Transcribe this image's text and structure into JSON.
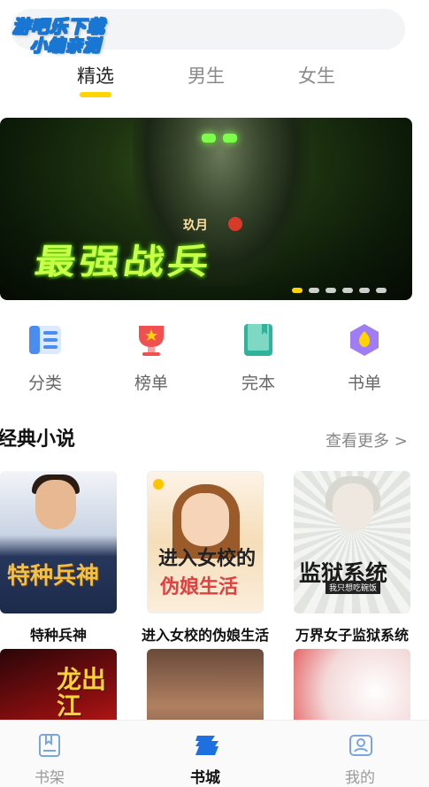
{
  "watermark": {
    "line1": "游吧乐下载",
    "line2": "小编亲测"
  },
  "tabs": [
    {
      "label": "精选",
      "active": true
    },
    {
      "label": "男生",
      "active": false
    },
    {
      "label": "女生",
      "active": false
    }
  ],
  "banner": {
    "author": "玖月",
    "title": "最强战兵",
    "slides": 6,
    "active_slide": 1
  },
  "categories": [
    {
      "label": "分类",
      "icon": "list-icon",
      "color": "#4a8cf0"
    },
    {
      "label": "榜单",
      "icon": "trophy-icon",
      "color": "#f05050"
    },
    {
      "label": "完本",
      "icon": "book-icon",
      "color": "#2fb39a"
    },
    {
      "label": "书单",
      "icon": "badge-icon",
      "color": "#8a5cf0"
    }
  ],
  "section": {
    "title": "经典小说",
    "more": "查看更多 >"
  },
  "books": [
    {
      "title": "特种兵神",
      "cover_text": "特种兵神"
    },
    {
      "title": "进入女校的伪娘生活",
      "cover_text_1": "进入女校的",
      "cover_text_2": "伪娘生活"
    },
    {
      "title": "万界女子监狱系统",
      "cover_text": "监狱系统",
      "cover_sub": "我只想吃碗饭"
    },
    {
      "cover_text": "龙出江"
    },
    {},
    {}
  ],
  "bottom_nav": [
    {
      "label": "书架",
      "icon": "bookshelf-icon",
      "active": false
    },
    {
      "label": "书城",
      "icon": "bookstore-icon",
      "active": true
    },
    {
      "label": "我的",
      "icon": "profile-icon",
      "active": false
    }
  ],
  "colors": {
    "accent": "#ffd400",
    "text_primary": "#222222",
    "text_muted": "#888888"
  }
}
